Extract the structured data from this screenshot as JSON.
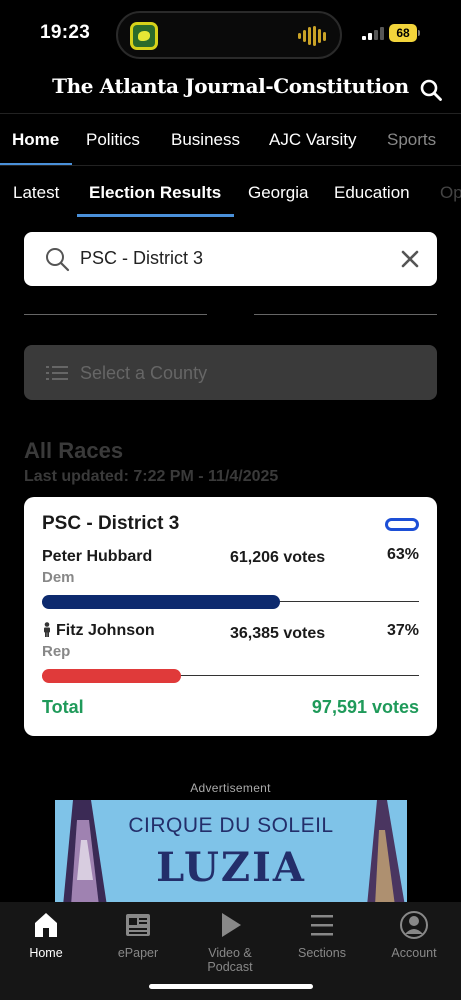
{
  "status_bar": {
    "time": "19:23",
    "battery": "68"
  },
  "masthead": {
    "title": "The Atlanta Journal-Constitution"
  },
  "primary_nav": {
    "tabs": [
      "Home",
      "Politics",
      "Business",
      "AJC Varsity",
      "Sports"
    ],
    "active": "Home"
  },
  "secondary_nav": {
    "tabs": [
      "Latest",
      "Election Results",
      "Georgia",
      "Education",
      "Op"
    ],
    "active": "Election Results"
  },
  "search": {
    "value": "PSC - District 3"
  },
  "county_select": {
    "placeholder": "Select a County"
  },
  "section": {
    "title": "All Races",
    "last_updated": "Last updated: 7:22 PM - 11/4/2025"
  },
  "race": {
    "title": "PSC - District 3",
    "candidates": [
      {
        "name": "Peter Hubbard",
        "party": "Dem",
        "votes": "61,206 votes",
        "percent": "63%",
        "share": 0.63,
        "color": "#0d2a6e",
        "incumbent": false
      },
      {
        "name": "Fitz Johnson",
        "party": "Rep",
        "votes": "36,385 votes",
        "percent": "37%",
        "share": 0.37,
        "color": "#e03a3a",
        "incumbent": true
      }
    ],
    "total_label": "Total",
    "total_votes": "97,591 votes"
  },
  "ad": {
    "label": "Advertisement",
    "line1": "CIRQUE DU SOLEIL",
    "line2": "LUZIA"
  },
  "tab_bar": {
    "items": [
      {
        "label": "Home",
        "icon": "home-icon"
      },
      {
        "label": "ePaper",
        "icon": "newspaper-icon"
      },
      {
        "label": "Video & Podcast",
        "icon": "play-icon"
      },
      {
        "label": "Sections",
        "icon": "menu-icon"
      },
      {
        "label": "Account",
        "icon": "account-icon"
      }
    ],
    "active": "Home"
  },
  "colors": {
    "accent": "#4a90d9",
    "total": "#1f9a5a",
    "dem": "#0d2a6e",
    "rep": "#e03a3a"
  }
}
